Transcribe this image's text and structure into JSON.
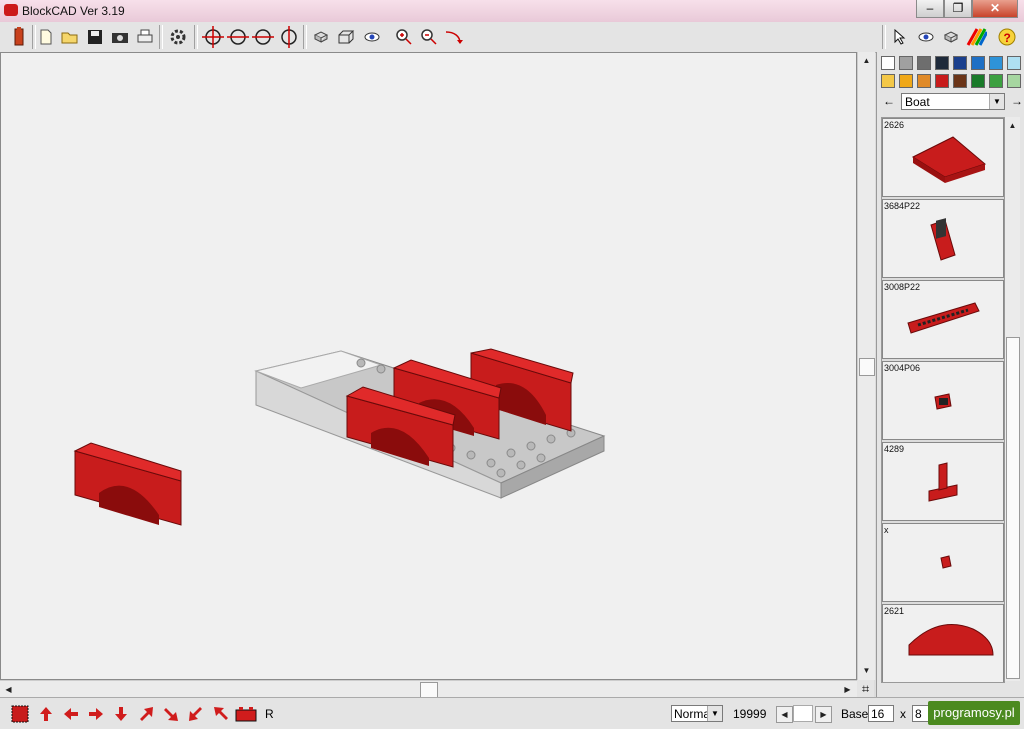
{
  "window": {
    "title": "BlockCAD Ver 3.19",
    "minimize": "–",
    "maximize": "❐",
    "close": "✕"
  },
  "toolbar": {
    "left_tools": [
      "logo-brick-icon",
      "new-file-icon",
      "open-folder-icon",
      "save-icon",
      "camera-icon",
      "print-icon",
      "settings-gear-icon"
    ],
    "rotate_tools": [
      "rotate-left-icon",
      "rotate-right-icon",
      "rotate-up-icon",
      "rotate-down-icon"
    ],
    "view_tools": [
      "single-brick-view-icon",
      "wireframe-view-icon",
      "eye-view-icon",
      "zoom-in-icon",
      "zoom-out-icon",
      "undo-arrow-icon"
    ],
    "right_tools": [
      "pointer-icon",
      "eye-icon",
      "brick-stack-icon",
      "color-rainbow-icon",
      "help-icon"
    ]
  },
  "palette": {
    "colors": [
      "#ffffff",
      "#a0a0a0",
      "#6e6e6e",
      "#1e2a3a",
      "#1a3f8c",
      "#1e6fc4",
      "#2e93d8",
      "#aee0f2",
      "#f4c848",
      "#f0a818",
      "#e08a28",
      "#c81c1c",
      "#6a3418",
      "#1a7a2a",
      "#3ca040",
      "#a6d6a0"
    ]
  },
  "category": {
    "selected": "Boat",
    "prev": "←",
    "next": "→"
  },
  "parts": [
    {
      "id": "2626"
    },
    {
      "id": "3684P22"
    },
    {
      "id": "3008P22"
    },
    {
      "id": "3004P06"
    },
    {
      "id": "4289"
    },
    {
      "id": "x"
    },
    {
      "id": "2621"
    }
  ],
  "status": {
    "mode": "Norma",
    "counter": "19999",
    "base_label": "Base:",
    "base_w": "16",
    "x_label": "x",
    "base_h": "8",
    "r_label": "R"
  },
  "watermark": "programosy.pl"
}
